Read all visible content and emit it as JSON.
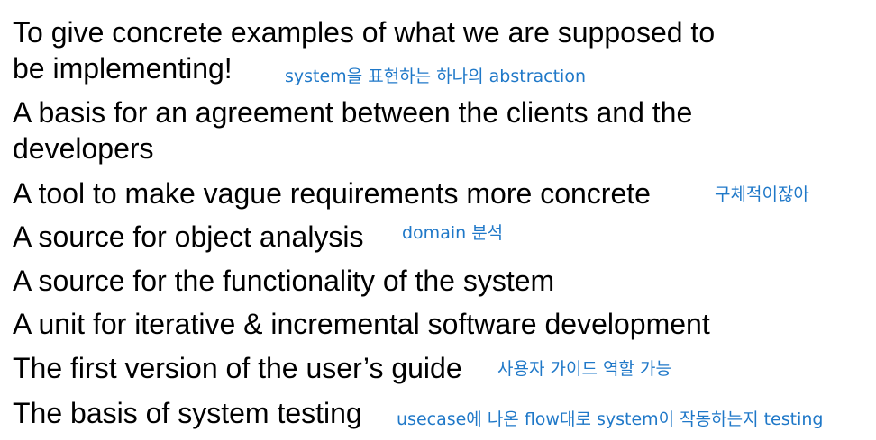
{
  "lines": [
    "To give concrete examples of what we are supposed to",
    "be implementing!",
    "A basis for an agreement between the clients and the",
    "developers",
    "A tool to make vague requirements more concrete",
    "A source for object analysis",
    "A source for the functionality of the system",
    "A unit for iterative & incremental software development",
    "The first version of the user’s guide",
    "The basis of system testing"
  ],
  "annotations": {
    "abstraction": "system을 표현하는 하나의 abstraction",
    "concrete": "구체적이잖아",
    "domain": "domain 분석",
    "user_guide": "사용자 가이드 역할 가능",
    "testing": "usecase에 나온 flow대로 system이 작동하는지 testing"
  },
  "colors": {
    "text": "#000000",
    "annotation": "#1f78c8"
  }
}
